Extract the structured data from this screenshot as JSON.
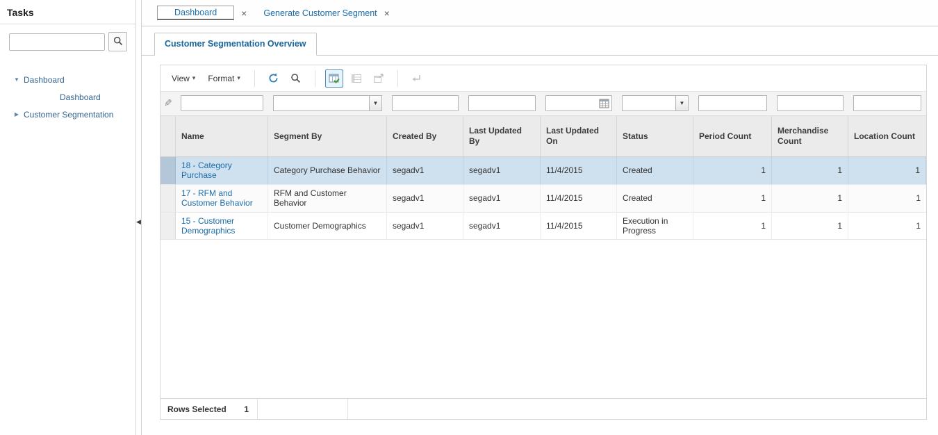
{
  "glyphs": {
    "caret": "▾",
    "close": "×",
    "pencil": "✎",
    "collapse_handle": "◀",
    "combo_arrow": "▼"
  },
  "sidebar": {
    "title": "Tasks",
    "search_value": "",
    "tree": [
      {
        "label": "Dashboard",
        "glyph": "▼",
        "state": "expanded"
      },
      {
        "label": "Dashboard",
        "glyph": "",
        "state": "leaf"
      },
      {
        "label": "Customer Segmentation",
        "glyph": "▶",
        "state": "collapsed"
      }
    ]
  },
  "tabs": [
    {
      "label": "Dashboard",
      "active": true
    },
    {
      "label": "Generate Customer Segment",
      "active": false
    }
  ],
  "subtab": {
    "label": "Customer Segmentation Overview"
  },
  "toolbar": {
    "view": "View",
    "format": "Format",
    "icons": [
      "refresh-icon",
      "search-icon",
      "query-by-example-icon",
      "freeze-icon",
      "detach-icon",
      "enter-arrow-icon"
    ]
  },
  "grid": {
    "columns": [
      "Name",
      "Segment By",
      "Created By",
      "Last Updated By",
      "Last Updated On",
      "Status",
      "Period Count",
      "Merchandise Count",
      "Location Count"
    ],
    "rows": [
      {
        "name": "18 - Category Purchase",
        "segment_by": "Category Purchase Behavior",
        "created_by": "segadv1",
        "last_updated_by": "segadv1",
        "last_updated_on": "11/4/2015",
        "status": "Created",
        "period_count": "1",
        "merchandise_count": "1",
        "location_count": "1",
        "selected": true
      },
      {
        "name": "17 - RFM and Customer Behavior",
        "segment_by": "RFM and Customer Behavior",
        "created_by": "segadv1",
        "last_updated_by": "segadv1",
        "last_updated_on": "11/4/2015",
        "status": "Created",
        "period_count": "1",
        "merchandise_count": "1",
        "location_count": "1",
        "selected": false
      },
      {
        "name": "15 - Customer Demographics",
        "segment_by": "Customer Demographics",
        "created_by": "segadv1",
        "last_updated_by": "segadv1",
        "last_updated_on": "11/4/2015",
        "status": "Execution in Progress",
        "period_count": "1",
        "merchandise_count": "1",
        "location_count": "1",
        "selected": false
      }
    ],
    "footer": {
      "rows_selected_label": "Rows Selected",
      "rows_selected_value": "1"
    }
  }
}
